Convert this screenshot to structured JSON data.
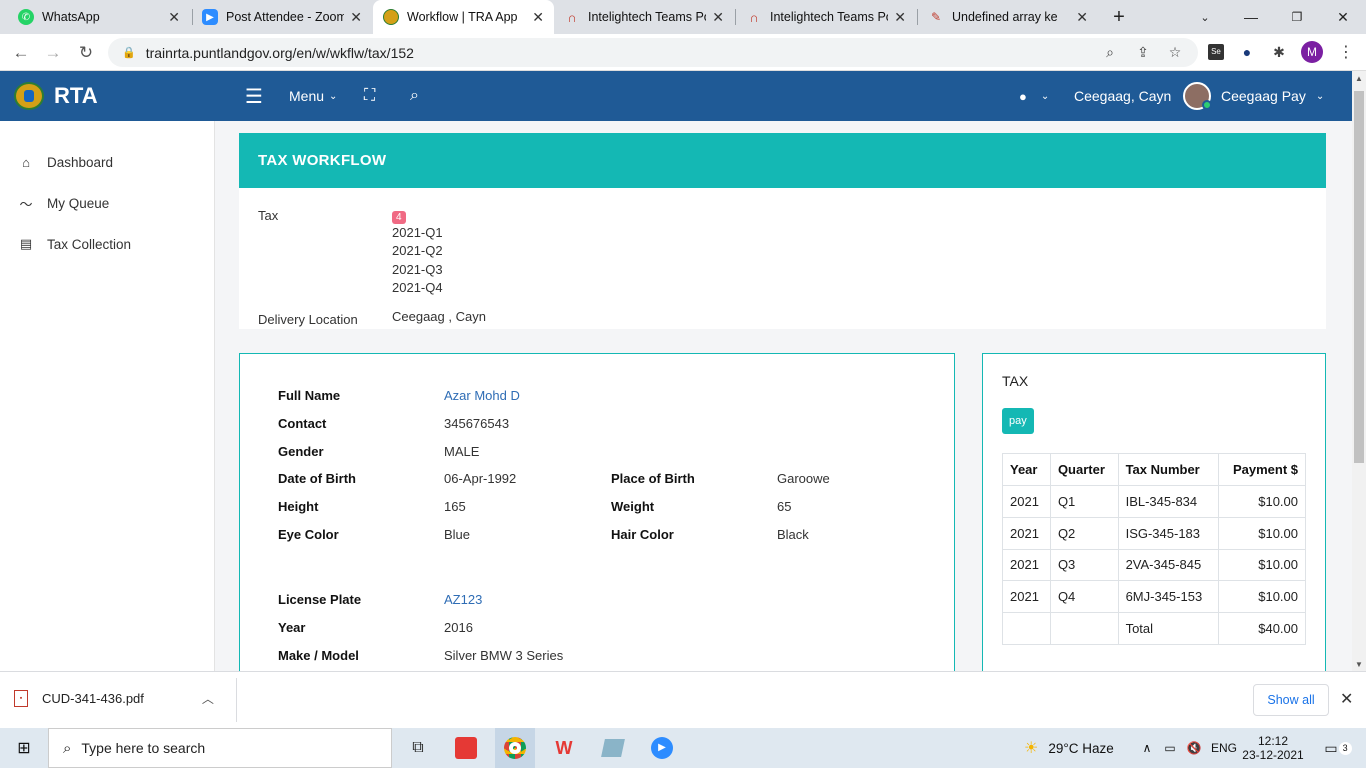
{
  "browser": {
    "tabs": [
      {
        "title": "WhatsApp",
        "icon": "whatsapp-icon",
        "color": "#25d366"
      },
      {
        "title": "Post Attendee - Zoom",
        "icon": "zoom-icon",
        "color": "#2d8cff"
      },
      {
        "title": "Workflow | TRA App",
        "icon": "tra-logo-icon",
        "color": "#d4a017"
      },
      {
        "title": "Intelightech Teams Po",
        "icon": "headset-icon",
        "color": "#c0392b"
      },
      {
        "title": "Intelightech Teams Po",
        "icon": "headset-icon",
        "color": "#c0392b"
      },
      {
        "title": "Undefined array ke",
        "icon": "bug-icon",
        "color": "#c0392b"
      }
    ],
    "url": "trainrta.puntlandgov.org/en/w/wkflw/tax/152",
    "profile_initial": "M"
  },
  "app": {
    "brand": "RTA",
    "menu_label": "Menu",
    "user_location": "Ceegaag, Cayn",
    "user_name": "Ceegaag Pay",
    "sidebar": [
      {
        "label": "Dashboard",
        "icon": "home-icon"
      },
      {
        "label": "My Queue",
        "icon": "chart-line-icon"
      },
      {
        "label": "Tax Collection",
        "icon": "list-icon"
      }
    ]
  },
  "workflow": {
    "title": "TAX WORKFLOW",
    "tax_label": "Tax",
    "tax_count": "4",
    "quarters": [
      "2021-Q1",
      "2021-Q2",
      "2021-Q3",
      "2021-Q4"
    ],
    "delivery_label": "Delivery Location",
    "delivery_value": "Ceegaag , Cayn"
  },
  "person": {
    "full_name_label": "Full Name",
    "full_name": "Azar Mohd D",
    "contact_label": "Contact",
    "contact": "345676543",
    "gender_label": "Gender",
    "gender": "MALE",
    "dob_label": "Date of Birth",
    "dob": "06-Apr-1992",
    "pob_label": "Place of Birth",
    "pob": "Garoowe",
    "height_label": "Height",
    "height": "165",
    "weight_label": "Weight",
    "weight": "65",
    "eye_label": "Eye Color",
    "eye": "Blue",
    "hair_label": "Hair Color",
    "hair": "Black",
    "plate_label": "License Plate",
    "plate": "AZ123",
    "year_label": "Year",
    "year": "2016",
    "make_label": "Make / Model",
    "make": "Silver BMW 3 Series"
  },
  "tax": {
    "title": "TAX",
    "pay_label": "pay",
    "columns": [
      "Year",
      "Quarter",
      "Tax Number",
      "Payment $"
    ],
    "rows": [
      [
        "2021",
        "Q1",
        "IBL-345-834",
        "$10.00"
      ],
      [
        "2021",
        "Q2",
        "ISG-345-183",
        "$10.00"
      ],
      [
        "2021",
        "Q3",
        "2VA-345-845",
        "$10.00"
      ],
      [
        "2021",
        "Q4",
        "6MJ-345-153",
        "$10.00"
      ]
    ],
    "total_label": "Total",
    "total_value": "$40.00"
  },
  "downloads": {
    "file": "CUD-341-436.pdf",
    "show_all": "Show all"
  },
  "taskbar": {
    "search_placeholder": "Type here to search",
    "weather": "29°C  Haze",
    "lang": "ENG",
    "time": "12:12",
    "date": "23-12-2021",
    "notifications": "3"
  },
  "colors": {
    "nav": "#1f5a96",
    "teal": "#14b8b4",
    "badge": "#f06a84",
    "link": "#2f6db5"
  }
}
